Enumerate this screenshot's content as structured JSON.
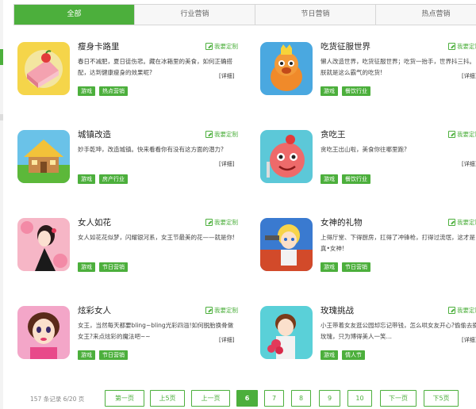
{
  "tabs": [
    "全部",
    "行业营销",
    "节日营销",
    "热点营销"
  ],
  "custom_label": "我要定制",
  "more_label": "[详细]",
  "cards": [
    {
      "title": "瘦身卡路里",
      "desc": "春日不减肥，夏日徒伤悲。藏在冰箱里的美食，如何正确搭配，达到健康瘦身的效果呢?",
      "tags": [
        "游戏",
        "热点营销"
      ]
    },
    {
      "title": "吃货征服世界",
      "desc": "懒人改造世界，吃货征服世界；吃货一抬手，世界抖三抖。朕就是这么霸气的吃货!",
      "tags": [
        "游戏",
        "餐饮行业"
      ]
    },
    {
      "title": "城镇改造",
      "desc": "妙手乾坤，改造城镇。快来看看你有没有这方面的潜力?",
      "tags": [
        "游戏",
        "房产行业"
      ]
    },
    {
      "title": "贪吃王",
      "desc": "贪吃王出山啦，美食你往哪里跑?",
      "tags": [
        "游戏",
        "餐饮行业"
      ]
    },
    {
      "title": "女人如花",
      "desc": "女人如花花似梦，闪耀银河系，女王节最美的花——就是你!",
      "tags": [
        "游戏",
        "节日营销"
      ]
    },
    {
      "title": "女神的礼物",
      "desc": "上得厅堂、下得厨房，扛得了冲锋枪，打得过流氓，这才是真•女神!",
      "tags": [
        "游戏",
        "节日营销"
      ]
    },
    {
      "title": "炫彩女人",
      "desc": "女王，当然每天都要bling~bling光彩四溢!如何脱胎换骨做女王?来点炫彩的魔法吧~~",
      "tags": [
        "游戏",
        "节日营销"
      ]
    },
    {
      "title": "玫瑰挑战",
      "desc": "小王带着女友逛公园却忘记带钱，怎么哄女友开心?偷偷去摘玫瑰，只为博得美人一笑…",
      "tags": [
        "游戏",
        "情人节"
      ]
    }
  ],
  "pagination": {
    "info": "157 条记录 6/20 页",
    "buttons": [
      "第一页",
      "上5页",
      "上一页",
      "6",
      "7",
      "8",
      "9",
      "10",
      "下一页",
      "下5页"
    ],
    "current": "6"
  }
}
